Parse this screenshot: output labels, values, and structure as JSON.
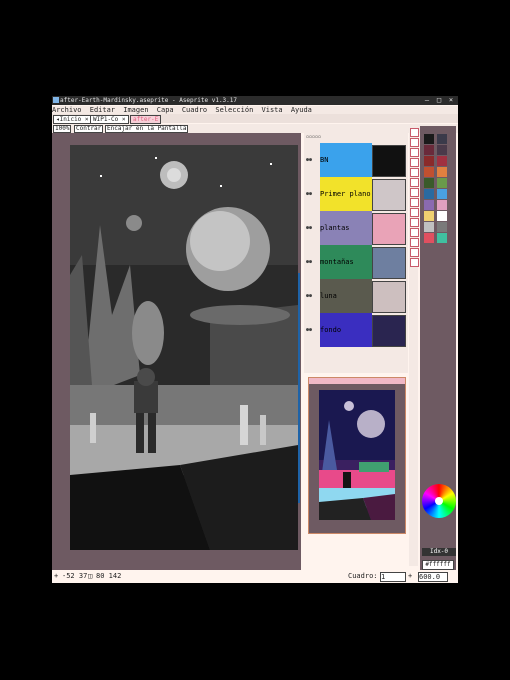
{
  "window": {
    "title": "after-Earth-Mardinsky.aseprite - Aseprite v1.3.17"
  },
  "menu": [
    "Archivo",
    "Editar",
    "Imagen",
    "Capa",
    "Cuadro",
    "Selección",
    "Vista",
    "Ayuda"
  ],
  "tabs": [
    {
      "label": "Inicio"
    },
    {
      "label": "WIP1-Co"
    },
    {
      "label": "after-E"
    }
  ],
  "context_bar": {
    "zoom": "100%",
    "contrast_label": "Contrar",
    "fit_label": "Encajar en la Pantalla"
  },
  "layers": [
    {
      "name": "BN",
      "color": "#3aa2ec"
    },
    {
      "name": "Primer plano",
      "color": "#f2e22a"
    },
    {
      "name": "plantas",
      "color": "#8a82b6"
    },
    {
      "name": "montañas",
      "color": "#2e8a5a"
    },
    {
      "name": "luna",
      "color": "#5a5a4e"
    },
    {
      "name": "fondo",
      "color": "#3a2ec0"
    }
  ],
  "status": {
    "cursor": "-52 37",
    "size": "80 142",
    "frame_label": "Cuadro:",
    "frame_value": "1",
    "zoom": "600.0"
  },
  "color_panel": {
    "index": "Idx-0",
    "hex": "#ffffff",
    "palette": [
      "#1a1a1a",
      "#3a3a4a",
      "#6a2a3a",
      "#4a3a4a",
      "#8a2a2a",
      "#a03040",
      "#c05030",
      "#e08040",
      "#3a5a2a",
      "#6a9a4a",
      "#2a6aa0",
      "#4aa0e0",
      "#8a6ab0",
      "#e0a0c0",
      "#f0d070",
      "#ffffff",
      "#c0c0c0",
      "#7a7a7a",
      "#e05060",
      "#40c0a0"
    ],
    "fg": "#ffffff"
  },
  "icons": {
    "minimize": "minimize-icon",
    "maximize": "maximize-icon",
    "close": "close-icon"
  }
}
